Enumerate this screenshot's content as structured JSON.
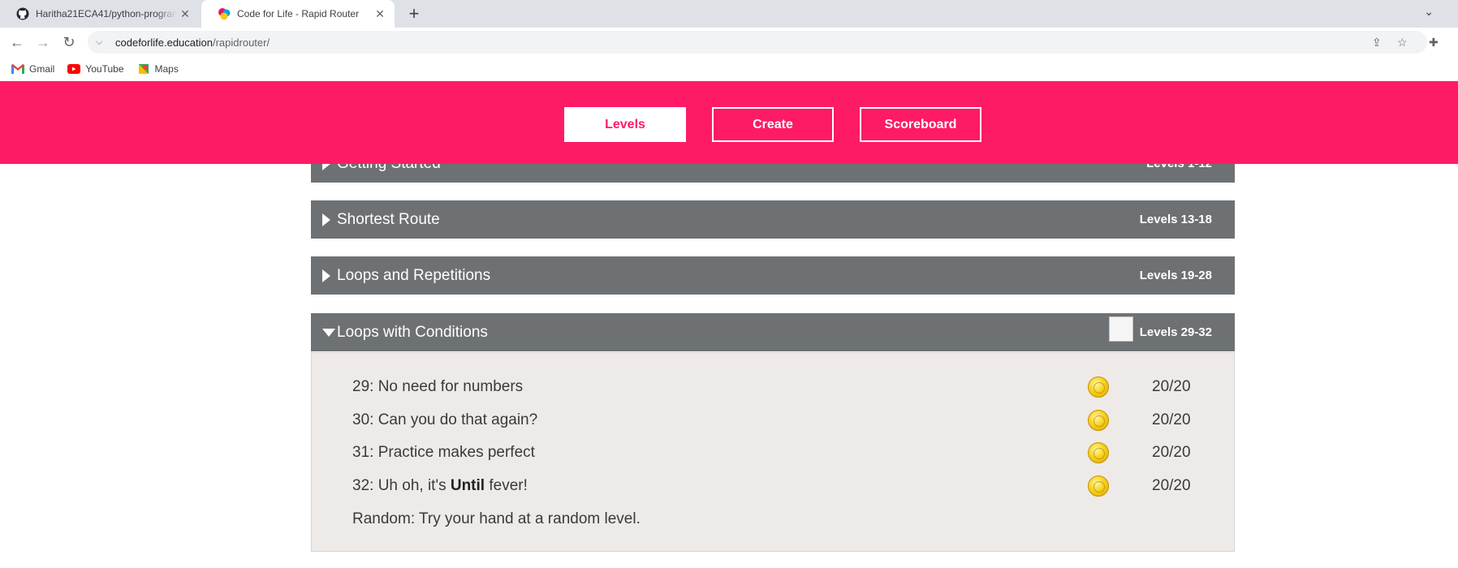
{
  "browser": {
    "tabs": [
      {
        "title": "Haritha21ECA41/python-program",
        "state": "inactive",
        "icon": "github-icon"
      },
      {
        "title": "Code for Life - Rapid Router",
        "state": "active",
        "icon": "codeforlife-icon"
      }
    ],
    "new_tab_label": "+",
    "tab_close_glyph": "✕",
    "url_host": "codeforlife.education",
    "url_path": "/rapidrouter/",
    "bookmarks": [
      {
        "label": "Gmail",
        "icon": "gmail-icon"
      },
      {
        "label": "YouTube",
        "icon": "youtube-icon"
      },
      {
        "label": "Maps",
        "icon": "maps-icon"
      }
    ]
  },
  "nav": {
    "buttons": [
      {
        "label": "Levels",
        "active": true
      },
      {
        "label": "Create",
        "active": false
      },
      {
        "label": "Scoreboard",
        "active": false
      }
    ],
    "color": "#ff1a66"
  },
  "episodes": [
    {
      "title": "Getting Started",
      "range": "Levels 1-12",
      "expanded": false
    },
    {
      "title": "Shortest Route",
      "range": "Levels 13-18",
      "expanded": false
    },
    {
      "title": "Loops and Repetitions",
      "range": "Levels 19-28",
      "expanded": false
    },
    {
      "title": "Loops with Conditions",
      "range": "Levels 29-32",
      "expanded": true
    }
  ],
  "levels": [
    {
      "prefix": "29: No need for numbers",
      "bold": "",
      "suffix": "",
      "score": "20/20"
    },
    {
      "prefix": "30: Can you do that again?",
      "bold": "",
      "suffix": "",
      "score": "20/20"
    },
    {
      "prefix": "31: Practice makes perfect",
      "bold": "",
      "suffix": "",
      "score": "20/20"
    },
    {
      "prefix": "32: Uh oh, it's ",
      "bold": "Until",
      "suffix": " fever!",
      "score": "20/20"
    }
  ],
  "random_level": "Random: Try your hand at a random level.",
  "colors": {
    "episode_header": "#6d7173",
    "panel_bg": "#eeeae8",
    "coin": "#f7d21e"
  }
}
